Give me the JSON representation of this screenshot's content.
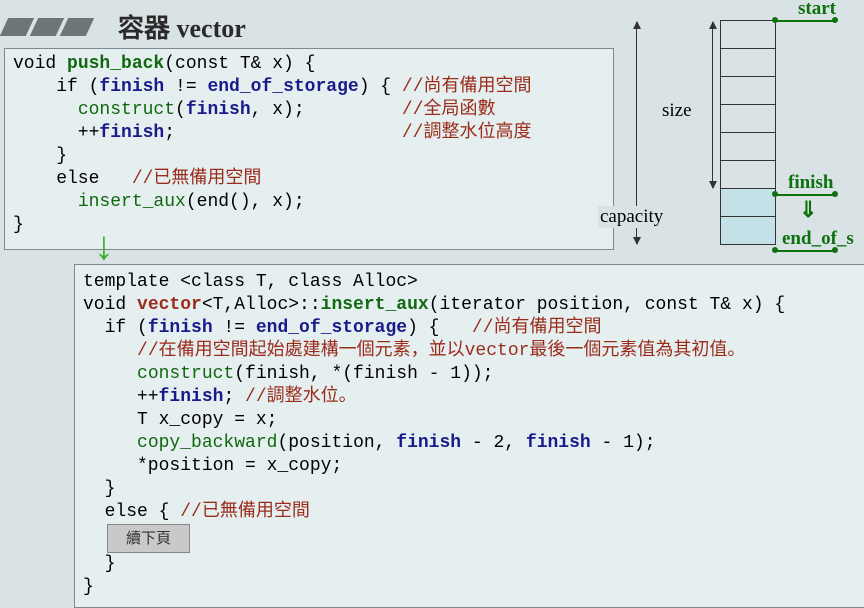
{
  "title": "容器 vector",
  "code1": {
    "l1_a": "void ",
    "l1_fn": "push_back",
    "l1_b": "(const T& x) {",
    "l2_a": "    if (",
    "l2_kw1": "finish",
    "l2_b": " != ",
    "l2_kw2": "end_of_storage",
    "l2_c": ") { ",
    "l2_cm": "//尚有備用空間",
    "l3_a": "      ",
    "l3_fn": "construct",
    "l3_b": "(",
    "l3_kw": "finish",
    "l3_c": ", x);         ",
    "l3_cm": "//全局函數",
    "l4_a": "      ++",
    "l4_kw": "finish",
    "l4_b": ";                     ",
    "l4_cm": "//調整水位高度",
    "l5": "    }",
    "l6_a": "    else   ",
    "l6_cm": "//已無備用空間",
    "l7_a": "      ",
    "l7_fn": "insert_aux",
    "l7_b": "(end(), x);",
    "l8": "}"
  },
  "code2": {
    "l1": "template <class T, class Alloc>",
    "l2_a": "void ",
    "l2_cls": "vector",
    "l2_b": "<T,Alloc>::",
    "l2_fn": "insert_aux",
    "l2_c": "(iterator position, const T& x) {",
    "l3_a": "  if (",
    "l3_kw1": "finish",
    "l3_b": " != ",
    "l3_kw2": "end_of_storage",
    "l3_c": ") {   ",
    "l3_cm": "//尚有備用空間",
    "l4_a": "     ",
    "l4_cm": "//在備用空間起始處建構一個元素，並以vector最後一個元素值為其初值。",
    "l5_a": "     ",
    "l5_fn": "construct",
    "l5_b": "(finish, *(finish - 1));",
    "l6_a": "     ++",
    "l6_kw": "finish",
    "l6_b": "; ",
    "l6_cm": "//調整水位。",
    "l7": "     T x_copy = x;",
    "l8_a": "     ",
    "l8_fn": "copy_backward",
    "l8_b": "(position, ",
    "l8_kw1": "finish",
    "l8_c": " - 2, ",
    "l8_kw2": "finish",
    "l8_d": " - 1);",
    "l9": "     *position = x_copy;",
    "l10": "  }",
    "l11_a": "  else { ",
    "l11_cm": "//已無備用空間",
    "l12_btn": "續下頁",
    "l13": "  }",
    "l14": "}"
  },
  "diagram": {
    "start": "start",
    "size": "size",
    "capacity": "capacity",
    "finish": "finish",
    "end_of_storage": "end_of_s"
  }
}
